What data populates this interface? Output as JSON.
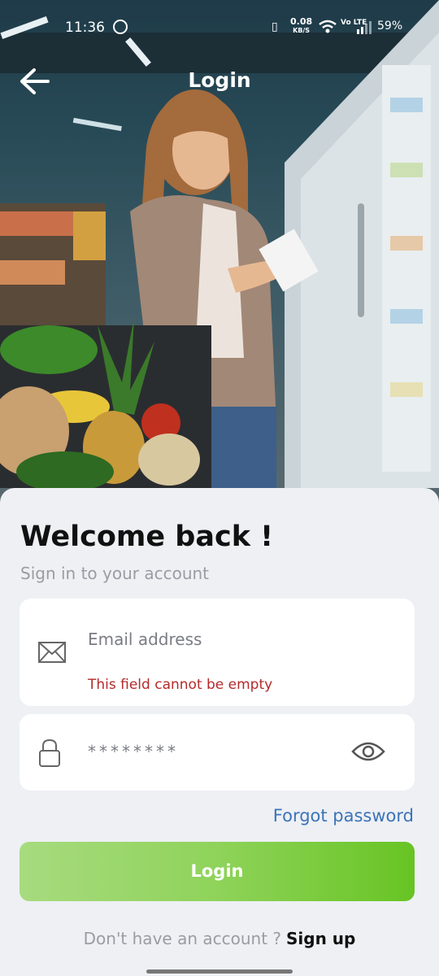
{
  "status_bar": {
    "time": "11:36",
    "net_speed_top": "0.08",
    "net_speed_bottom": "KB/S",
    "volte": "Vo LTE",
    "battery": "59%"
  },
  "header": {
    "title": "Login",
    "back_icon": "arrow-left-icon"
  },
  "card": {
    "welcome": "Welcome back !",
    "subtitle": "Sign in to your account"
  },
  "email_field": {
    "icon": "envelope-icon",
    "placeholder": "Email address",
    "error": "This field cannot be empty"
  },
  "password_field": {
    "icon": "lock-icon",
    "placeholder": "********",
    "toggle_icon": "eye-icon"
  },
  "forgot_label": "Forgot password",
  "login_label": "Login",
  "signup": {
    "question": "Don't have an account ?",
    "link": "Sign up"
  },
  "colors": {
    "accent_green_start": "#a7db7f",
    "accent_green_end": "#67c423",
    "link_blue": "#3b74b8",
    "error_red": "#b52a2a"
  }
}
